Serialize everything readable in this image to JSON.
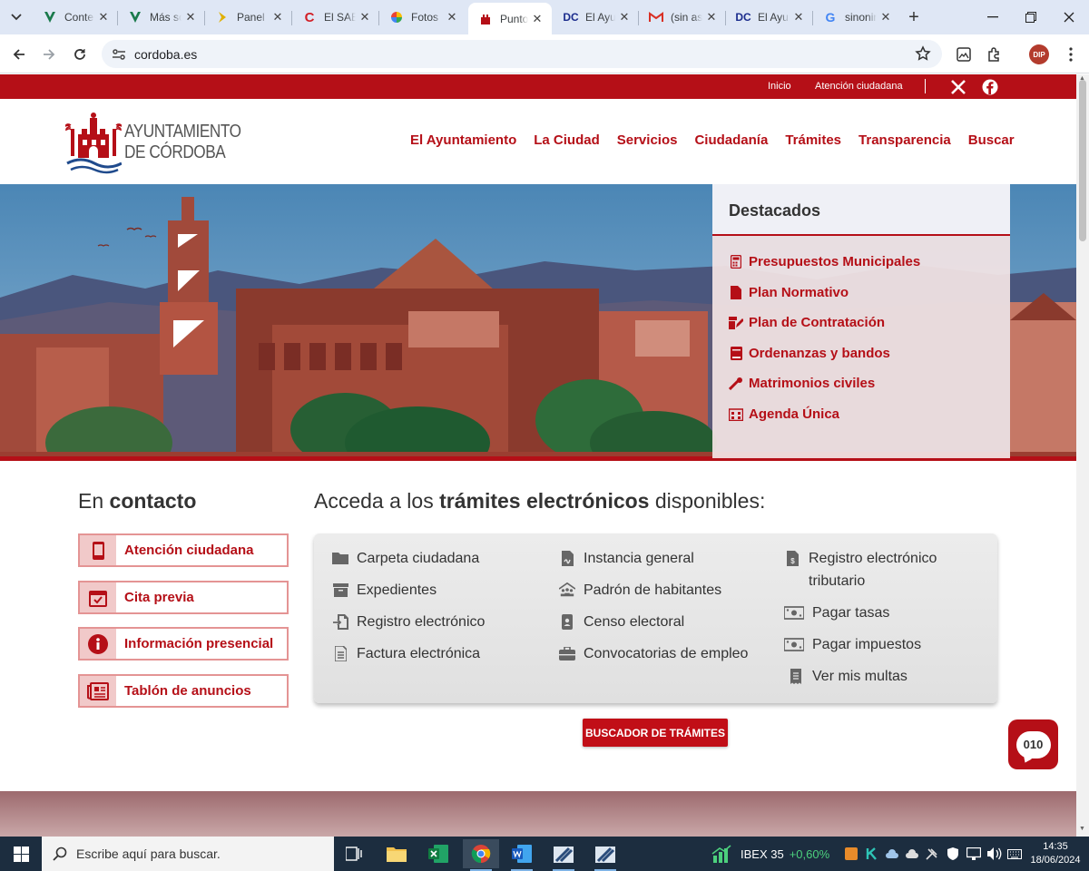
{
  "browser": {
    "tabs": [
      {
        "title": "Contenido",
        "favicon": "vuetify-v-icon",
        "fav_color": "#1a7a4c"
      },
      {
        "title": "Más sobre",
        "favicon": "vuetify-v-icon",
        "fav_color": "#1a7a4c"
      },
      {
        "title": "Panel",
        "favicon": "arrow-right-icon",
        "fav_color": "#e0b000"
      },
      {
        "title": "El SAE",
        "favicon": "c-logo-icon",
        "fav_color": "#d21f26"
      },
      {
        "title": "Fotos",
        "favicon": "pinwheel-icon",
        "fav_color": "#4285f4"
      },
      {
        "title": "Punto",
        "favicon": "cordoba-crest-icon",
        "fav_color": "#b50f17"
      },
      {
        "title": "El Ayun",
        "favicon": "dc-logo-icon",
        "fav_color": "#1a2b8c"
      },
      {
        "title": "(sin asunto)",
        "favicon": "gmail-icon",
        "fav_color": "#d93025"
      },
      {
        "title": "El Ayun",
        "favicon": "dc-logo-icon",
        "fav_color": "#1a2b8c"
      },
      {
        "title": "sinonimos",
        "favicon": "google-icon",
        "fav_color": "#4285f4"
      }
    ],
    "url": "cordoba.es",
    "profile_initials": "DIP"
  },
  "site": {
    "topbar": {
      "links": [
        "Inicio",
        "Atención ciudadana"
      ]
    },
    "logo": {
      "line1": "AYUNTAMIENTO",
      "line2": "DE CÓRDOBA"
    },
    "nav": [
      "El Ayuntamiento",
      "La Ciudad",
      "Servicios",
      "Ciudadanía",
      "Trámites",
      "Transparencia",
      "Buscar"
    ],
    "destacados": {
      "title": "Destacados",
      "items": [
        {
          "label": "Presupuestos Municipales",
          "icon": "calculator-icon"
        },
        {
          "label": "Plan Normativo",
          "icon": "document-icon"
        },
        {
          "label": "Plan de Contratación",
          "icon": "edit-document-icon"
        },
        {
          "label": "Ordenanzas y bandos",
          "icon": "book-icon"
        },
        {
          "label": "Matrimonios civiles",
          "icon": "ring-icon"
        },
        {
          "label": "Agenda Única",
          "icon": "calendar-icon"
        }
      ]
    },
    "contacto": {
      "title_prefix": "En",
      "title_bold": "contacto",
      "items": [
        {
          "label": "Atención ciudadana",
          "icon": "mobile-phone-icon"
        },
        {
          "label": "Cita previa",
          "icon": "calendar-check-icon"
        },
        {
          "label": "Información presencial",
          "icon": "info-icon"
        },
        {
          "label": "Tablón de anuncios",
          "icon": "newspaper-icon"
        }
      ]
    },
    "tramites": {
      "title_prefix": "Acceda a los",
      "title_bold": "trámites electrónicos",
      "title_suffix": "disponibles:",
      "col1": [
        {
          "label": "Carpeta ciudadana",
          "icon": "folder-icon"
        },
        {
          "label": "Expedientes",
          "icon": "archive-icon"
        },
        {
          "label": "Registro electrónico",
          "icon": "file-import-icon"
        },
        {
          "label": "Factura electrónica",
          "icon": "invoice-icon"
        }
      ],
      "col2": [
        {
          "label": "Instancia general",
          "icon": "file-signature-icon"
        },
        {
          "label": "Padrón de habitantes",
          "icon": "people-roof-icon"
        },
        {
          "label": "Censo electoral",
          "icon": "id-badge-icon"
        },
        {
          "label": "Convocatorias de empleo",
          "icon": "briefcase-icon"
        }
      ],
      "col3": [
        {
          "label": "Registro electrónico tributario",
          "icon": "file-invoice-dollar-icon"
        },
        {
          "label": "Pagar tasas",
          "icon": "money-bill-icon"
        },
        {
          "label": "Pagar impuestos",
          "icon": "money-bill-icon"
        },
        {
          "label": "Ver mis multas",
          "icon": "receipt-icon"
        }
      ],
      "search_button": "BUSCADOR DE TRÁMITES"
    },
    "chat_widget": "010"
  },
  "taskbar": {
    "search_placeholder": "Escribe aquí para buscar.",
    "stock_name": "IBEX 35",
    "stock_change": "+0,60%",
    "time": "14:35",
    "date": "18/06/2024"
  },
  "colors": {
    "brand": "#b50f17",
    "accent_light": "#f1c9c9"
  }
}
